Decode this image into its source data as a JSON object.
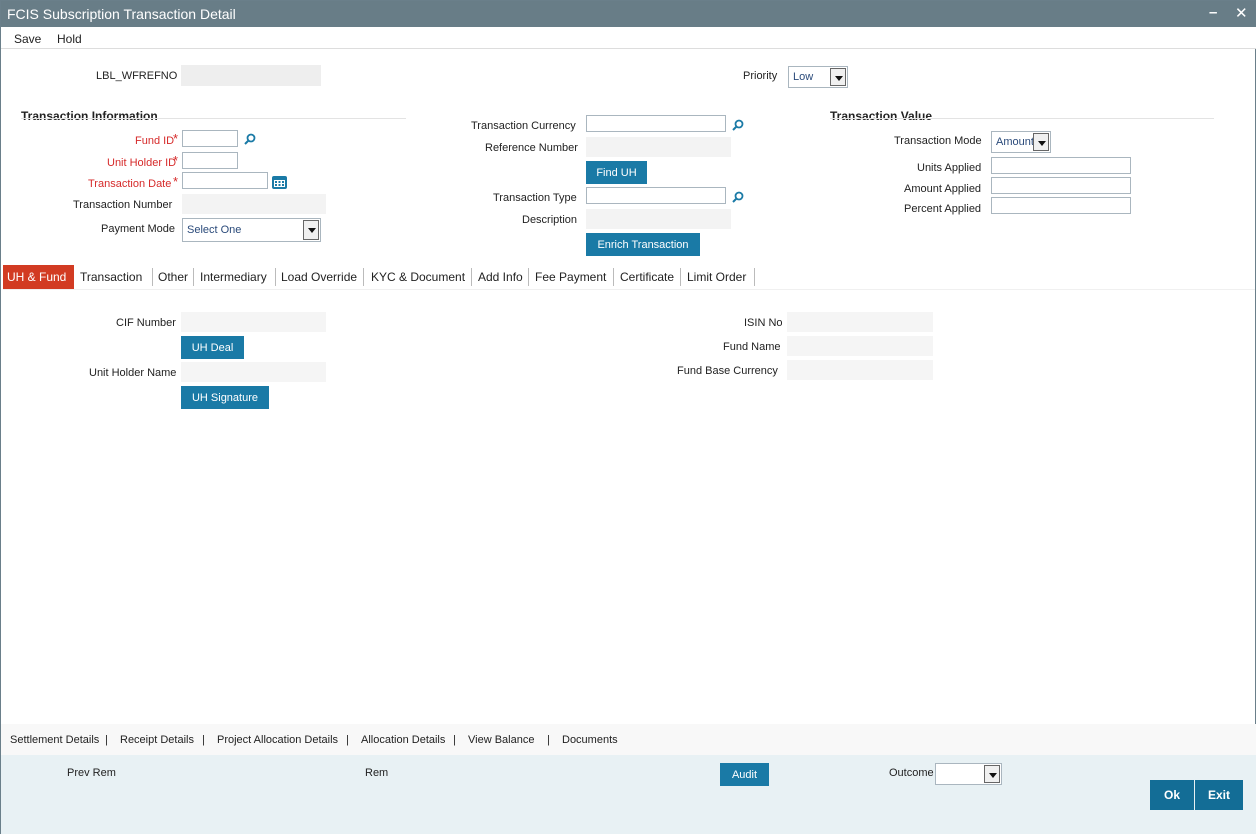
{
  "window": {
    "title": "FCIS Subscription Transaction Detail",
    "minimize": "–",
    "close": "✕"
  },
  "menu": {
    "save": "Save",
    "hold": "Hold"
  },
  "header": {
    "wfrefno_label": "LBL_WFREFNO",
    "priority_label": "Priority",
    "priority_value": "Low"
  },
  "txn_info": {
    "title": "Transaction Information",
    "fund_id_label": "Fund ID",
    "unit_holder_id_label": "Unit Holder ID",
    "transaction_date_label": "Transaction Date",
    "transaction_number_label": "Transaction Number",
    "payment_mode_label": "Payment Mode",
    "payment_mode_value": "Select One",
    "required_mark": "*"
  },
  "middle": {
    "currency_label": "Transaction Currency",
    "reference_label": "Reference Number",
    "find_uh": "Find UH",
    "type_label": "Transaction Type",
    "description_label": "Description",
    "enrich": "Enrich Transaction"
  },
  "txn_value": {
    "title": "Transaction Value",
    "mode_label": "Transaction Mode",
    "mode_value": "Amount",
    "units_label": "Units Applied",
    "amount_label": "Amount Applied",
    "percent_label": "Percent Applied"
  },
  "tabs": [
    "UH & Fund",
    "Transaction",
    "Other",
    "Intermediary",
    "Load Override",
    "KYC & Document",
    "Add Info",
    "Fee Payment",
    "Certificate",
    "Limit Order"
  ],
  "uh_fund": {
    "cif_label": "CIF Number",
    "uh_deal": "UH Deal",
    "uh_name_label": "Unit Holder Name",
    "uh_signature": "UH Signature",
    "isin_label": "ISIN No",
    "fund_name_label": "Fund Name",
    "fund_base_currency_label": "Fund Base Currency"
  },
  "footer_links": [
    "Settlement Details",
    "|",
    "Receipt Details",
    "|",
    "Project Allocation Details",
    "|",
    "Allocation Details",
    "|",
    "View Balance",
    "|",
    "Documents"
  ],
  "footer": {
    "prev_rem": "Prev Rem",
    "rem": "Rem",
    "audit": "Audit",
    "outcome_label": "Outcome",
    "ok": "Ok",
    "exit": "Exit"
  }
}
